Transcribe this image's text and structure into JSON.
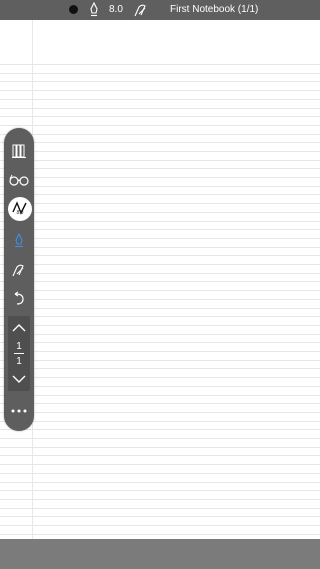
{
  "topbar": {
    "pen_size": "8.0",
    "notebook_title": "First Notebook (1/1)"
  },
  "toolbar": {
    "brush_size_label": "8.0",
    "page_current": "1",
    "page_total": "1"
  },
  "colors": {
    "topbar_bg": "#5f5f5f",
    "toolbar_bg": "#5e5e5e",
    "active_tool": "#3a8fe6",
    "bottombar_bg": "#7b7b7b"
  }
}
